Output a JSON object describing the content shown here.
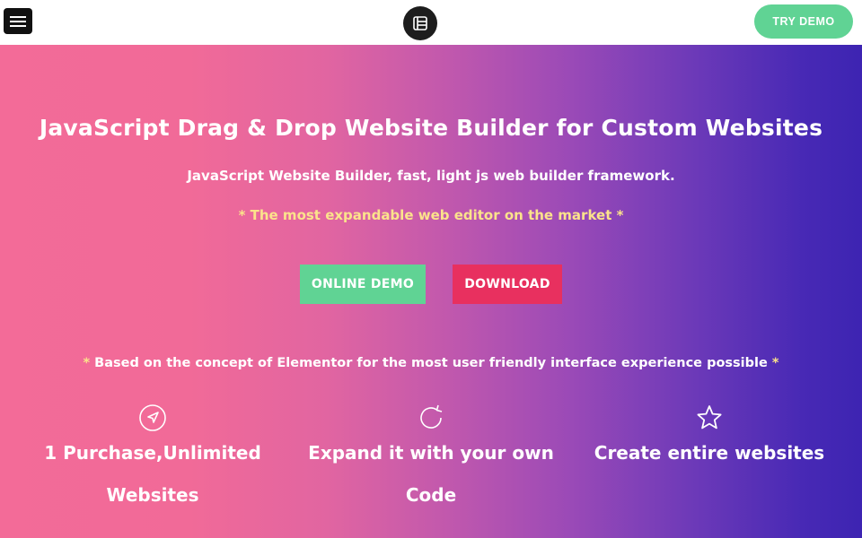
{
  "header": {
    "menu_icon": "hamburger-icon",
    "logo_icon": "builder-logo-icon",
    "try_demo_label": "TRY DEMO"
  },
  "hero": {
    "title": "JavaScript Drag & Drop Website Builder for Custom Websites",
    "subtitle": "JavaScript Website Builder, fast, light js web builder framework.",
    "tagline": "* The most expandable web editor on the market *",
    "online_demo_label": "ONLINE DEMO",
    "download_label": "DOWNLOAD",
    "concept_star_left": "*",
    "concept_text": " Based on the concept of Elementor for the most user friendly interface experience possible ",
    "concept_star_right": "*"
  },
  "features": [
    {
      "icon": "navigation-arrow-icon",
      "title": "1 Purchase,Unlimited Websites"
    },
    {
      "icon": "refresh-icon",
      "title": "Expand it with your own Code"
    },
    {
      "icon": "star-icon",
      "title": "Create entire websites"
    }
  ],
  "colors": {
    "gradient_start": "#f36b98",
    "gradient_end": "#3d24b2",
    "accent_green": "#60d394",
    "accent_red": "#e8305f",
    "tagline_yellow": "#fbe38b"
  }
}
